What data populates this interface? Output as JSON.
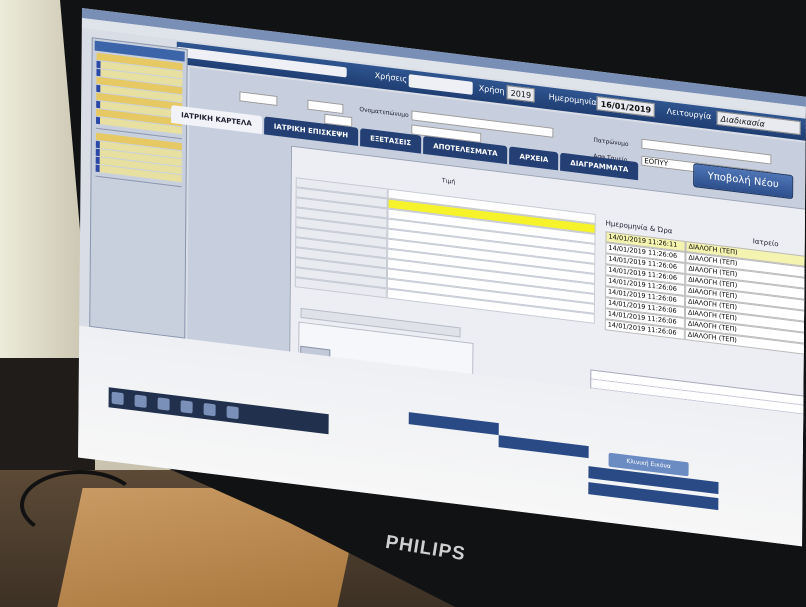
{
  "header": {
    "year_label": "Χρήσεις",
    "year_label2": "Χρήση",
    "year_value": "2019",
    "date_label": "Ημερομηνία",
    "date_value": "16/01/2019",
    "function_label": "Λειτουργία",
    "function_value": "Διαδικασία"
  },
  "form": {
    "surname_label": "Ονοματεπώνυμο",
    "father_label": "Πατρώνυμο",
    "fund_label": "Ασφ.Ταμείο",
    "fund_value": "ΕΟΠΥΥ"
  },
  "tabs": [
    {
      "label": "ΙΑΤΡΙΚΗ ΚΑΡΤΕΛΑ"
    },
    {
      "label": "ΙΑΤΡΙΚΗ ΕΠΙΣΚΕΨΗ"
    },
    {
      "label": "ΕΞΕΤΑΣΕΙΣ"
    },
    {
      "label": "ΑΠΟΤΕΛΕΣΜΑΤΑ"
    },
    {
      "label": "ΑΡΧΕΙΑ"
    },
    {
      "label": "ΔΙΑΓΡΑΜΜΑΤΑ"
    }
  ],
  "submit_label": "Υποβολή Νέου",
  "grid": {
    "date_header": "Ημερομηνία & Ώρα",
    "doctor_header": "Ιατρείο",
    "rows": [
      {
        "date": "14/01/2019 11:26:11",
        "doctor": "ΔΙΑΛΟΓΗ (ΤΕΠ)"
      },
      {
        "date": "14/01/2019 11:26:06",
        "doctor": "ΔΙΑΛΟΓΗ (ΤΕΠ)"
      },
      {
        "date": "14/01/2019 11:26:06",
        "doctor": "ΔΙΑΛΟΓΗ (ΤΕΠ)"
      },
      {
        "date": "14/01/2019 11:26:06",
        "doctor": "ΔΙΑΛΟΓΗ (ΤΕΠ)"
      },
      {
        "date": "14/01/2019 11:26:06",
        "doctor": "ΔΙΑΛΟΓΗ (ΤΕΠ)"
      },
      {
        "date": "14/01/2019 11:26:06",
        "doctor": "ΔΙΑΛΟΓΗ (ΤΕΠ)"
      },
      {
        "date": "14/01/2019 11:26:06",
        "doctor": "ΔΙΑΛΟΓΗ (ΤΕΠ)"
      },
      {
        "date": "14/01/2019 11:26:06",
        "doctor": "ΔΙΑΛΟΓΗ (ΤΕΠ)"
      },
      {
        "date": "14/01/2019 11:26:06",
        "doctor": "ΔΙΑΛΟΓΗ (ΤΕΠ)"
      }
    ]
  },
  "left_grid": {
    "title": "Τιμή",
    "rows": [
      "",
      "",
      "",
      "",
      "",
      "",
      "",
      "",
      "",
      "",
      ""
    ]
  },
  "clinical_label": "Κλινική Εικόνα",
  "brand": "PHILIPS"
}
